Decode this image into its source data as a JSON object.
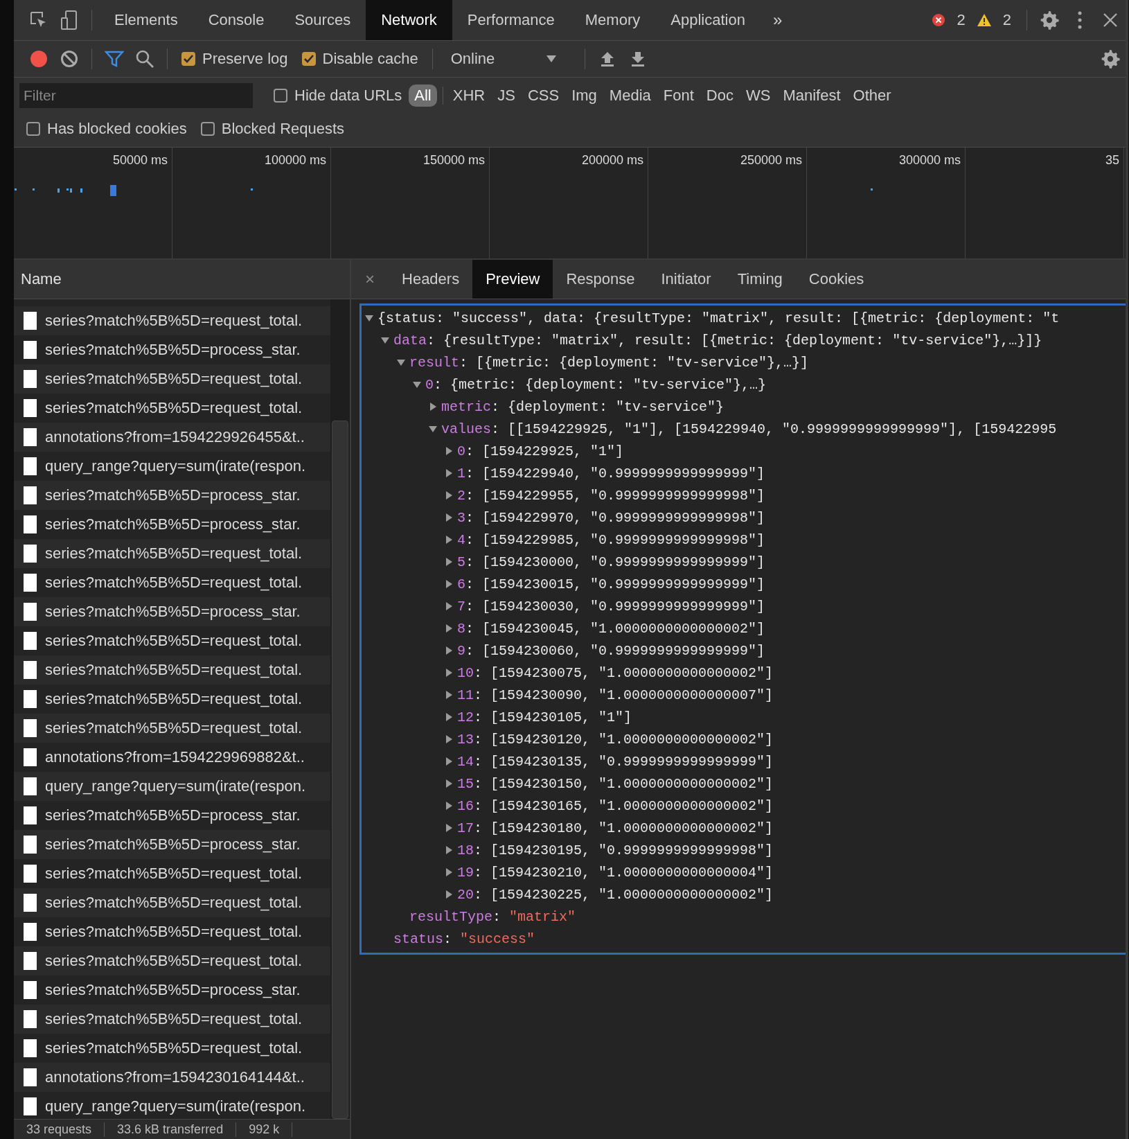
{
  "main_tabs": [
    {
      "label": "Elements",
      "selected": false
    },
    {
      "label": "Console",
      "selected": false
    },
    {
      "label": "Sources",
      "selected": false
    },
    {
      "label": "Network",
      "selected": true
    },
    {
      "label": "Performance",
      "selected": false
    },
    {
      "label": "Memory",
      "selected": false
    },
    {
      "label": "Application",
      "selected": false
    }
  ],
  "more_tabs": "»",
  "errors": "2",
  "warnings": "2",
  "toolbar": {
    "recording": true,
    "preserve_log": {
      "label": "Preserve log",
      "checked": true
    },
    "disable_cache": {
      "label": "Disable cache",
      "checked": true
    },
    "throttling": "Online"
  },
  "filter": {
    "placeholder": "Filter",
    "hide_data_urls": {
      "label": "Hide data URLs",
      "checked": false
    },
    "types": [
      {
        "label": "All",
        "selected": true
      },
      {
        "label": "XHR",
        "selected": false
      },
      {
        "label": "JS",
        "selected": false
      },
      {
        "label": "CSS",
        "selected": false
      },
      {
        "label": "Img",
        "selected": false
      },
      {
        "label": "Media",
        "selected": false
      },
      {
        "label": "Font",
        "selected": false
      },
      {
        "label": "Doc",
        "selected": false
      },
      {
        "label": "WS",
        "selected": false
      },
      {
        "label": "Manifest",
        "selected": false
      },
      {
        "label": "Other",
        "selected": false
      }
    ],
    "options": [
      {
        "label": "Has blocked cookies",
        "checked": false
      },
      {
        "label": "Blocked Requests",
        "checked": false
      }
    ]
  },
  "timeline": {
    "ticks": [
      "50000 ms",
      "100000 ms",
      "150000 ms",
      "200000 ms",
      "250000 ms",
      "300000 ms",
      "35"
    ]
  },
  "requests": {
    "column": "Name",
    "rows": [
      "series?match%5B%5D=request_total.",
      "series?match%5B%5D=process_star.",
      "series?match%5B%5D=request_total.",
      "series?match%5B%5D=request_total.",
      "annotations?from=1594229926455&t..",
      "query_range?query=sum(irate(respon.",
      "series?match%5B%5D=process_star.",
      "series?match%5B%5D=process_star.",
      "series?match%5B%5D=request_total.",
      "series?match%5B%5D=request_total.",
      "series?match%5B%5D=process_star.",
      "series?match%5B%5D=request_total.",
      "series?match%5B%5D=request_total.",
      "series?match%5B%5D=request_total.",
      "series?match%5B%5D=request_total.",
      "annotations?from=1594229969882&t..",
      "query_range?query=sum(irate(respon.",
      "series?match%5B%5D=process_star.",
      "series?match%5B%5D=process_star.",
      "series?match%5B%5D=request_total.",
      "series?match%5B%5D=request_total.",
      "series?match%5B%5D=request_total.",
      "series?match%5B%5D=request_total.",
      "series?match%5B%5D=process_star.",
      "series?match%5B%5D=request_total.",
      "series?match%5B%5D=request_total.",
      "annotations?from=1594230164144&t..",
      "query_range?query=sum(irate(respon."
    ]
  },
  "status_bar": [
    "33 requests",
    "33.6 kB transferred",
    "992 k"
  ],
  "detail_close": "×",
  "detail_tabs": [
    {
      "label": "Headers",
      "selected": false
    },
    {
      "label": "Preview",
      "selected": true
    },
    {
      "label": "Response",
      "selected": false
    },
    {
      "label": "Initiator",
      "selected": false
    },
    {
      "label": "Timing",
      "selected": false
    },
    {
      "label": "Cookies",
      "selected": false
    }
  ],
  "preview": {
    "tree": {
      "kind": "object",
      "expanded": true,
      "text": "{status: \"success\", data: {resultType: \"matrix\", result: [{metric: {deployment: \"t",
      "children": [
        {
          "kind": "object",
          "key": "data",
          "expanded": true,
          "text": ": {resultType: \"matrix\", result: [{metric: {deployment: \"tv-service\"},…}]}",
          "children": [
            {
              "kind": "object",
              "key": "result",
              "expanded": true,
              "text": ": [{metric: {deployment: \"tv-service\"},…}]",
              "children": [
                {
                  "kind": "object",
                  "key": "0",
                  "expanded": true,
                  "text": ": {metric: {deployment: \"tv-service\"},…}",
                  "children": [
                    {
                      "kind": "object",
                      "key": "metric",
                      "expanded": false,
                      "text": ": {deployment: \"tv-service\"}"
                    },
                    {
                      "kind": "object",
                      "key": "values",
                      "expanded": true,
                      "text": ": [[1594229925, \"1\"], [1594229940, \"0.9999999999999999\"], [159422995",
                      "children": [
                        {
                          "kind": "object",
                          "key": "0",
                          "expanded": false,
                          "text": ": [1594229925, \"1\"]"
                        },
                        {
                          "kind": "object",
                          "key": "1",
                          "expanded": false,
                          "text": ": [1594229940, \"0.9999999999999999\"]"
                        },
                        {
                          "kind": "object",
                          "key": "2",
                          "expanded": false,
                          "text": ": [1594229955, \"0.9999999999999998\"]"
                        },
                        {
                          "kind": "object",
                          "key": "3",
                          "expanded": false,
                          "text": ": [1594229970, \"0.9999999999999998\"]"
                        },
                        {
                          "kind": "object",
                          "key": "4",
                          "expanded": false,
                          "text": ": [1594229985, \"0.9999999999999998\"]"
                        },
                        {
                          "kind": "object",
                          "key": "5",
                          "expanded": false,
                          "text": ": [1594230000, \"0.9999999999999999\"]"
                        },
                        {
                          "kind": "object",
                          "key": "6",
                          "expanded": false,
                          "text": ": [1594230015, \"0.9999999999999999\"]"
                        },
                        {
                          "kind": "object",
                          "key": "7",
                          "expanded": false,
                          "text": ": [1594230030, \"0.9999999999999999\"]"
                        },
                        {
                          "kind": "object",
                          "key": "8",
                          "expanded": false,
                          "text": ": [1594230045, \"1.0000000000000002\"]"
                        },
                        {
                          "kind": "object",
                          "key": "9",
                          "expanded": false,
                          "text": ": [1594230060, \"0.9999999999999999\"]"
                        },
                        {
                          "kind": "object",
                          "key": "10",
                          "expanded": false,
                          "text": ": [1594230075, \"1.0000000000000002\"]"
                        },
                        {
                          "kind": "object",
                          "key": "11",
                          "expanded": false,
                          "text": ": [1594230090, \"1.0000000000000007\"]"
                        },
                        {
                          "kind": "object",
                          "key": "12",
                          "expanded": false,
                          "text": ": [1594230105, \"1\"]"
                        },
                        {
                          "kind": "object",
                          "key": "13",
                          "expanded": false,
                          "text": ": [1594230120, \"1.0000000000000002\"]"
                        },
                        {
                          "kind": "object",
                          "key": "14",
                          "expanded": false,
                          "text": ": [1594230135, \"0.9999999999999999\"]"
                        },
                        {
                          "kind": "object",
                          "key": "15",
                          "expanded": false,
                          "text": ": [1594230150, \"1.0000000000000002\"]"
                        },
                        {
                          "kind": "object",
                          "key": "16",
                          "expanded": false,
                          "text": ": [1594230165, \"1.0000000000000002\"]"
                        },
                        {
                          "kind": "object",
                          "key": "17",
                          "expanded": false,
                          "text": ": [1594230180, \"1.0000000000000002\"]"
                        },
                        {
                          "kind": "object",
                          "key": "18",
                          "expanded": false,
                          "text": ": [1594230195, \"0.9999999999999998\"]"
                        },
                        {
                          "kind": "object",
                          "key": "19",
                          "expanded": false,
                          "text": ": [1594230210, \"1.0000000000000004\"]"
                        },
                        {
                          "kind": "object",
                          "key": "20",
                          "expanded": false,
                          "text": ": [1594230225, \"1.0000000000000002\"]"
                        }
                      ]
                    }
                  ]
                }
              ]
            },
            {
              "kind": "string",
              "key": "resultType",
              "text": ": ",
              "value": "\"matrix\""
            }
          ]
        },
        {
          "kind": "string",
          "key": "status",
          "text": ": ",
          "value": "\"success\""
        }
      ]
    }
  }
}
